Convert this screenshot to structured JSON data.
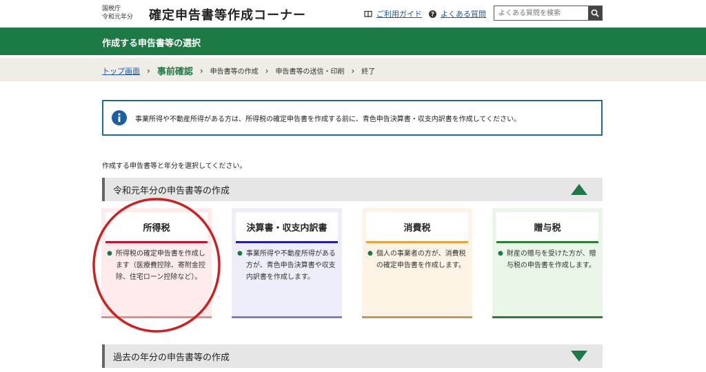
{
  "header": {
    "agency_line1": "国税庁",
    "agency_line2": "令和元年分",
    "title": "確定申告書等作成コーナー",
    "guide_link": "ご利用ガイド",
    "faq_link": "よくある質問",
    "search_placeholder": "よくある質問を検索"
  },
  "page_title": "作成する申告書等の選択",
  "breadcrumb": {
    "home": "トップ画面",
    "current": "事前確認",
    "step3": "申告書等の作成",
    "step4": "申告書等の送信・印刷",
    "step5": "終了"
  },
  "notice": {
    "text": "事業所得や不動産所得がある方は、所得税の確定申告書を作成する前に、青色申告決算書・収支内訳書を作成してください。"
  },
  "prompt": "作成する申告書等と年分を選択してください。",
  "sections": {
    "current_year": "令和元年分の申告書等の作成",
    "past_years": "過去の年分の申告書等の作成"
  },
  "cards": [
    {
      "title": "所得税",
      "desc": "所得税の確定申告書を作成します（医療費控除、寄附金控除、住宅ローン控除など）。",
      "bg": "#fdeceb",
      "accent": "#c8102e",
      "bottom": "#e08f8a"
    },
    {
      "title": "決算書・収支内訳書",
      "desc": "事業所得や不動産所得がある方が、青色申告決算書や収支内訳書を作成します。",
      "bg": "#eeeefb",
      "accent": "#1f1fa6",
      "bottom": "#7e7ec8"
    },
    {
      "title": "消費税",
      "desc": "個人の事業者の方が、消費税の確定申告書を作成します。",
      "bg": "#fdf4e6",
      "accent": "#e8a33d",
      "bottom": "#c8955a"
    },
    {
      "title": "贈与税",
      "desc": "財産の贈与を受けた方が、贈与税の申告書を作成します。",
      "bg": "#eaf6e8",
      "accent": "#2e7d32",
      "bottom": "#2e7d32"
    }
  ],
  "colors": {
    "brand_green": "#1e7a45",
    "link_blue": "#1a56b0",
    "highlight_red": "#d11f1f"
  }
}
